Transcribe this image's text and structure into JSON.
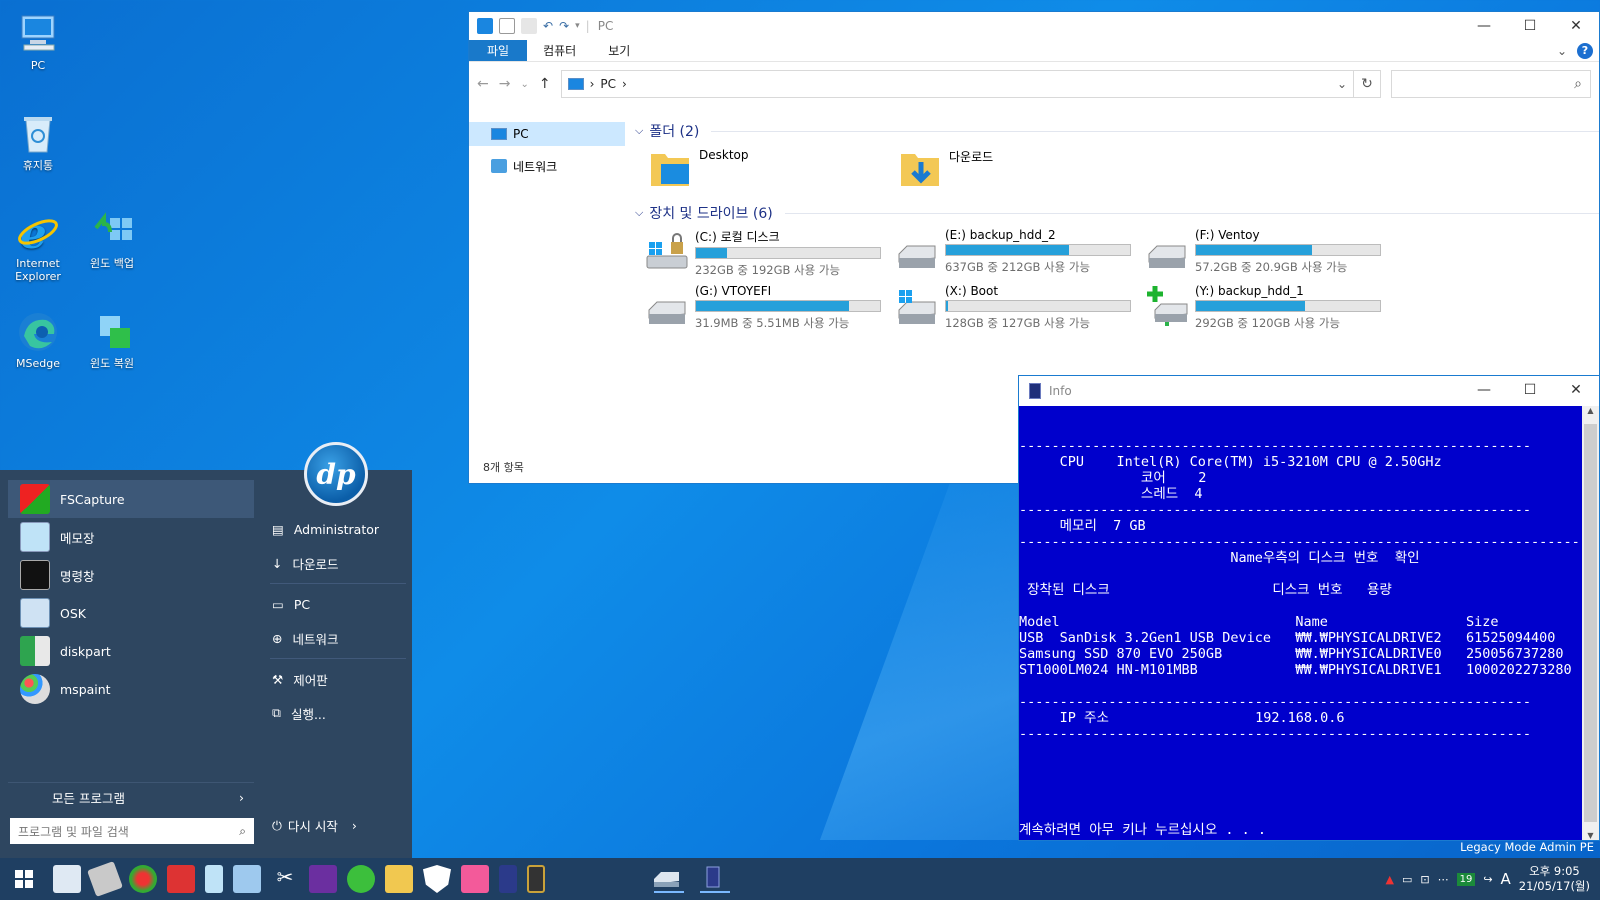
{
  "desktop": {
    "icons": [
      {
        "label": "PC"
      },
      {
        "label": "휴지통"
      },
      {
        "label": "Internet Explorer"
      },
      {
        "label": "윈도 백업"
      },
      {
        "label": "MSedge"
      },
      {
        "label": "윈도 복원"
      }
    ],
    "legacy_text": "Legacy Mode Admin PE"
  },
  "explorer": {
    "title": "PC",
    "ribbon_tabs": [
      "파일",
      "컴퓨터",
      "보기"
    ],
    "address": "PC",
    "nav": [
      {
        "label": "PC"
      },
      {
        "label": "네트워크"
      }
    ],
    "folders_header": "폴더 (2)",
    "folders": [
      {
        "label": "Desktop"
      },
      {
        "label": "다운로드"
      }
    ],
    "drives_header": "장치 및 드라이브 (6)",
    "drives": [
      {
        "label": "(C:) 로컬 디스크",
        "free": "232GB 중 192GB 사용 가능",
        "used": 0.17
      },
      {
        "label": "(E:) backup_hdd_2",
        "free": "637GB 중 212GB 사용 가능",
        "used": 0.67
      },
      {
        "label": "(F:) Ventoy",
        "free": "57.2GB 중 20.9GB 사용 가능",
        "used": 0.63
      },
      {
        "label": "(G:) VTOYEFI",
        "free": "31.9MB 중 5.51MB 사용 가능",
        "used": 0.83
      },
      {
        "label": "(X:) Boot",
        "free": "128GB 중 127GB 사용 가능",
        "used": 0.01
      },
      {
        "label": "(Y:) backup_hdd_1",
        "free": "292GB 중 120GB 사용 가능",
        "used": 0.59
      }
    ],
    "status": "8개 항목"
  },
  "info": {
    "title": "Info",
    "lines": [
      "---------------------------------------------------------------",
      "     CPU    Intel(R) Core(TM) i5-3210M CPU @ 2.50GHz",
      "               코어    2",
      "               스레드  4",
      "---------------------------------------------------------------",
      "     메모리  7 GB",
      "----------------------------------------------------------------------------",
      "                          Name우측의 디스크 번호  확인",
      "",
      " 장착된 디스크                    디스크 번호   용량",
      "",
      "Model                             Name                 Size",
      "USB  SanDisk 3.2Gen1 USB Device   ₩₩.₩PHYSICALDRIVE2   61525094400",
      "Samsung SSD 870 EVO 250GB         ₩₩.₩PHYSICALDRIVE0   250056737280",
      "ST1000LM024 HN-M101MBB            ₩₩.₩PHYSICALDRIVE1   1000202273280",
      "",
      "---------------------------------------------------------------",
      "     IP 주소                  192.168.0.6",
      "---------------------------------------------------------------",
      "",
      "",
      "",
      "",
      "",
      "계속하려면 아무 키나 누르십시오 . . ."
    ]
  },
  "start_menu": {
    "programs": [
      {
        "label": "FSCapture"
      },
      {
        "label": "메모장"
      },
      {
        "label": "명령창"
      },
      {
        "label": "OSK"
      },
      {
        "label": "diskpart"
      },
      {
        "label": "mspaint"
      }
    ],
    "all_programs": "모든 프로그램",
    "search_placeholder": "프로그램 및 파일 검색",
    "right_items": [
      {
        "label": "Administrator"
      },
      {
        "label": "다운로드"
      },
      {
        "label": "PC"
      },
      {
        "label": "네트워크"
      },
      {
        "label": "제어판"
      },
      {
        "label": "실행..."
      }
    ],
    "restart": "다시 시작",
    "logo": "dp"
  },
  "taskbar": {
    "tray_badge": "19",
    "ime": "A",
    "time": "오후 9:05",
    "date": "21/05/17(월)"
  },
  "colors": {
    "accent": "#1979ca",
    "console_bg": "#0000cc",
    "start_bg": "#2e4660",
    "taskbar_bg": "#1f3f62",
    "drive_bar": "#26a0da"
  }
}
